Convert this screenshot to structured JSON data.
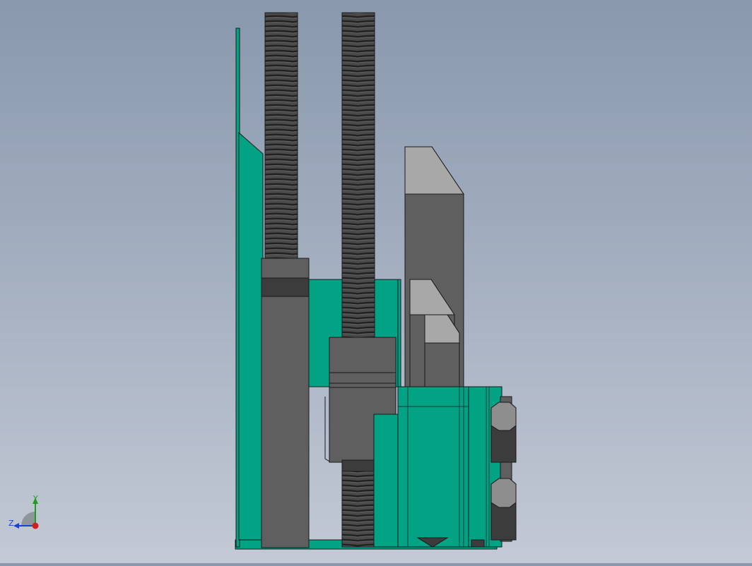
{
  "viewport": {
    "background_top": "#8998ad",
    "background_bottom": "#c3c9d5"
  },
  "colors": {
    "sheet_metal": "#02a384",
    "sheet_metal_dark": "#017a62",
    "sheet_metal_edge": "#0b3d33",
    "steel_dark": "#5f5f5f",
    "steel_mid": "#8c8c8c",
    "steel_light": "#b9b9b9",
    "thread": "#3a3a3a",
    "nut": "#3c3c3c",
    "nut_light": "#8e8e8e",
    "outline": "#1a1a1a"
  },
  "axis_triad": {
    "y_label": "Y",
    "z_label": "Z",
    "y_color": "#1e9e1e",
    "z_color": "#1f3fd0",
    "x_color": "#d01f1f"
  }
}
